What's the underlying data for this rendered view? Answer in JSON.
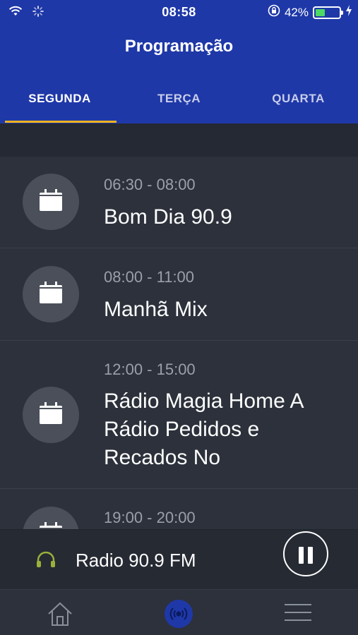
{
  "status_bar": {
    "time": "08:58",
    "battery_percent": "42%",
    "battery_level": 0.42,
    "icons": [
      "wifi-icon",
      "activity-spinner-icon",
      "orientation-lock-icon",
      "battery-icon",
      "charging-bolt-icon"
    ]
  },
  "header": {
    "title": "Programação",
    "tabs": [
      {
        "label": "SEGUNDA",
        "active": true
      },
      {
        "label": "TERÇA",
        "active": false
      },
      {
        "label": "QUARTA",
        "active": false
      }
    ]
  },
  "schedule": [
    {
      "time": "06:30 - 08:00",
      "title": "Bom Dia 90.9",
      "icon": "calendar-icon"
    },
    {
      "time": "08:00 - 11:00",
      "title": "Manhã Mix",
      "icon": "calendar-icon"
    },
    {
      "time": "12:00 - 15:00",
      "title": "Rádio Magia Home A Rádio Pedidos e Recados No",
      "icon": "calendar-icon"
    },
    {
      "time": "19:00 - 20:00",
      "title": "",
      "icon": "calendar-icon"
    }
  ],
  "player": {
    "station": "Radio 90.9 FM",
    "state": "playing",
    "icons": [
      "headphones-icon",
      "pause-icon"
    ]
  },
  "bottom_nav": {
    "items": [
      "home-icon",
      "radio-broadcast-icon",
      "menu-icon"
    ],
    "active": "radio-broadcast-icon"
  },
  "colors": {
    "header_bg": "#1f38a8",
    "tab_indicator": "#f3b41c",
    "list_bg": "#2c313b",
    "headphones": "#9bb13a"
  }
}
